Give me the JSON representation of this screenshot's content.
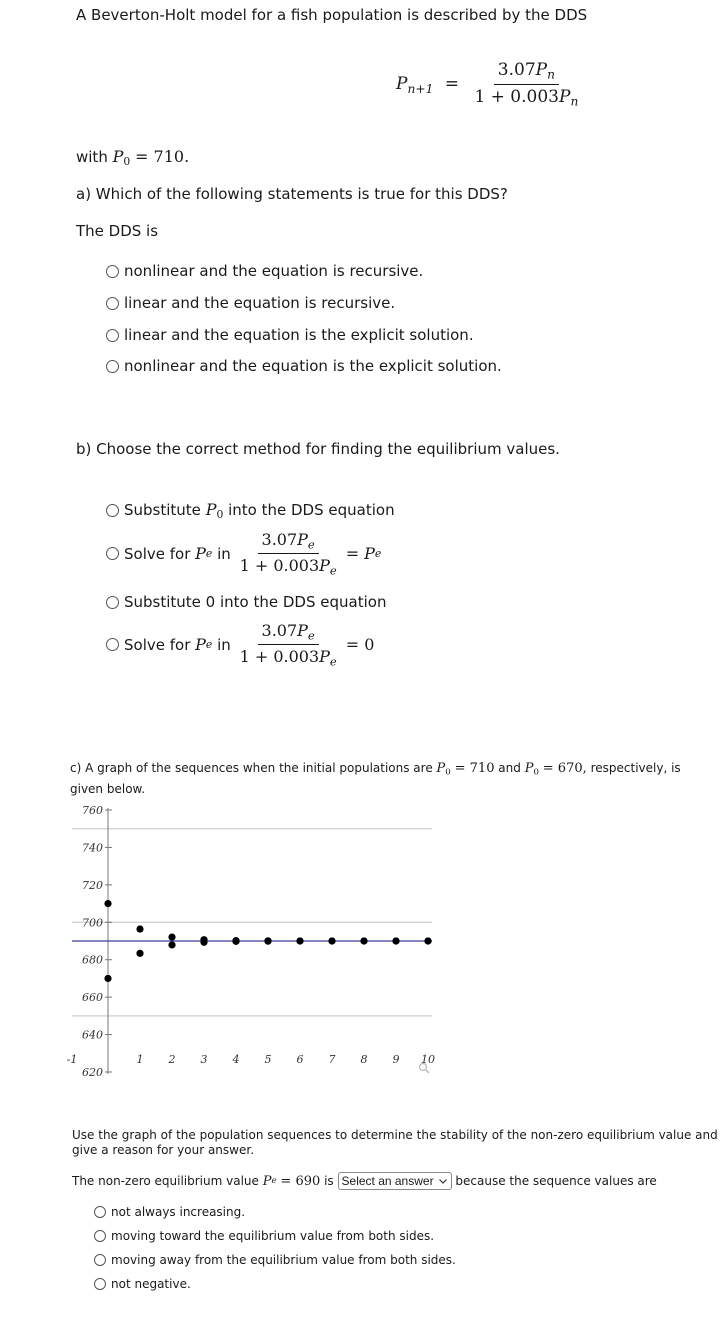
{
  "intro": {
    "text": "A Beverton-Holt model for a fish population is described by the DDS",
    "equation": {
      "lhs_var": "P",
      "lhs_sub": "n+1",
      "equals": "=",
      "numerator_coef": "3.07",
      "numerator_var": "P",
      "numerator_sub": "n",
      "denominator_prefix": "1 + 0.003",
      "denominator_var": "P",
      "denominator_sub": "n"
    },
    "initial_prefix": "with",
    "initial_var": "P",
    "initial_sub": "0",
    "initial_value": "= 710."
  },
  "part_a": {
    "question": "a) Which of the following statements is true for this DDS?",
    "lead": "The DDS is",
    "options": [
      "nonlinear and the equation is recursive.",
      "linear and the equation is recursive.",
      "linear and the equation is the explicit solution.",
      "nonlinear and the equation is the explicit solution."
    ]
  },
  "part_b": {
    "question": "b) Choose the correct method for finding the equilibrium values.",
    "options": {
      "opt1_prefix": "Substitute",
      "opt1_var": "P",
      "opt1_sub": "0",
      "opt1_suffix": "into the DDS equation",
      "opt2_prefix": "Solve for",
      "opt2_var": "P",
      "opt2_sub": "e",
      "opt2_in": "in",
      "opt2_num_coef": "3.07",
      "opt2_den_prefix": "1 + 0.003",
      "opt2_rhs_eq": "=",
      "opt2_rhs_var": "P",
      "opt2_rhs_sub": "e",
      "opt3_text": "Substitute 0 into the DDS equation",
      "opt4_prefix": "Solve for",
      "opt4_var": "P",
      "opt4_sub": "e",
      "opt4_in": "in",
      "opt4_num_coef": "3.07",
      "opt4_den_prefix": "1 + 0.003",
      "opt4_rhs": "= 0"
    }
  },
  "part_c": {
    "text_prefix": "c) A graph of the sequences when the initial populations are",
    "var": "P",
    "sub": "0",
    "val1": "= 710",
    "and": "and",
    "val2": "= 670,",
    "text_suffix": "respectively, is",
    "text_line2": "given below.",
    "zoom_icon": "magnifier-icon"
  },
  "chart_data": {
    "type": "scatter",
    "title": "",
    "xlabel": "",
    "ylabel": "",
    "xlim": [
      -1,
      10
    ],
    "ylim": [
      620,
      760
    ],
    "x_ticks": [
      "-1",
      "1",
      "2",
      "3",
      "4",
      "5",
      "6",
      "7",
      "8",
      "9",
      "10"
    ],
    "y_ticks": [
      "760",
      "740",
      "720",
      "700",
      "680",
      "660",
      "640",
      "620"
    ],
    "gridlines_y": [
      750,
      700,
      650
    ],
    "grid": true,
    "equilibrium_line": {
      "y": 690,
      "color": "#3a3fa0"
    },
    "series": [
      {
        "name": "P0 = 710",
        "x": [
          0,
          1,
          2,
          3,
          4,
          5,
          6,
          7,
          8,
          9,
          10
        ],
        "values": [
          710,
          696.4,
          692.1,
          690.7,
          690.2,
          690.1,
          690.0,
          690.0,
          690.0,
          690.0,
          690.0
        ]
      },
      {
        "name": "P0 = 670",
        "x": [
          0,
          1,
          2,
          3,
          4,
          5,
          6,
          7,
          8,
          9,
          10
        ],
        "values": [
          670,
          683.4,
          687.9,
          689.3,
          689.8,
          689.9,
          690.0,
          690.0,
          690.0,
          690.0,
          690.0
        ]
      }
    ],
    "point_color": "#000000"
  },
  "stability": {
    "prompt_line1": "Use the graph of the population sequences to determine the stability of the non-zero equilibrium value and",
    "prompt_line2": "give a reason for your answer.",
    "sentence_prefix": "The non-zero equilibrium value",
    "var": "P",
    "sub": "e",
    "value": "= 690",
    "is": "is",
    "select_value": "Select an answer",
    "sentence_suffix": "because the sequence values are",
    "options": [
      "not always increasing.",
      "moving toward the equilibrium value from both sides.",
      "moving away from the equilibrium value from both sides.",
      "not negative."
    ]
  }
}
